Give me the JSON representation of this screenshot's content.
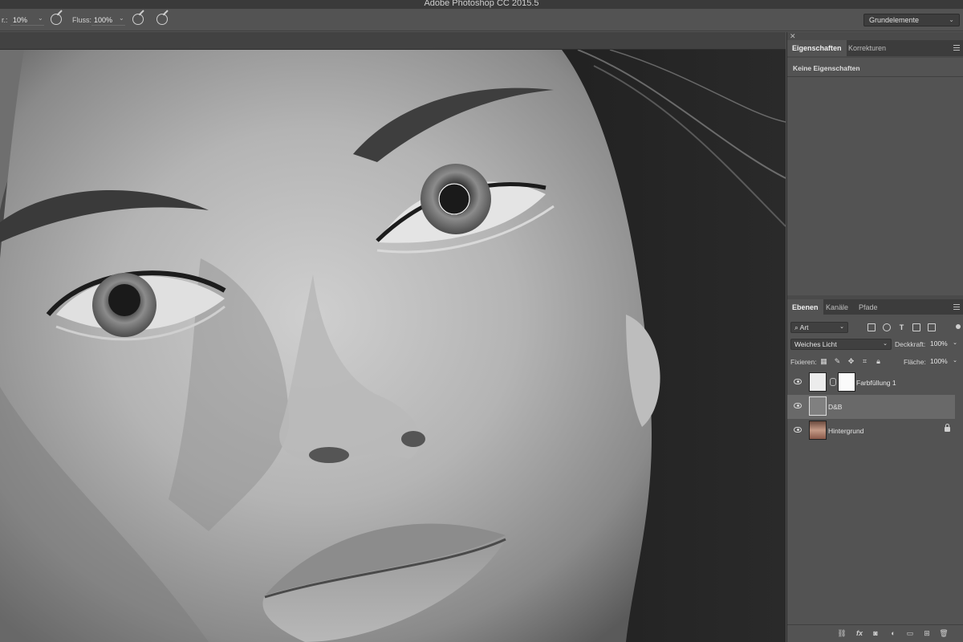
{
  "window": {
    "title": "Adobe Photoshop CC 2015.5"
  },
  "options_bar": {
    "opacity_label_partial": "r.:",
    "opacity_value": "10%",
    "flow_label": "Fluss:",
    "flow_value": "100%",
    "workspace": "Grundelemente"
  },
  "properties_panel": {
    "tabs": [
      {
        "label": "Eigenschaften",
        "active": true
      },
      {
        "label": "Korrekturen",
        "active": false
      }
    ],
    "empty_text": "Keine Eigenschaften"
  },
  "layers_panel": {
    "tabs": [
      {
        "label": "Ebenen",
        "active": true
      },
      {
        "label": "Kanäle",
        "active": false
      },
      {
        "label": "Pfade",
        "active": false
      }
    ],
    "filter_kind": "Art",
    "blend_mode": "Weiches Licht",
    "opacity_label": "Deckkraft:",
    "opacity_value": "100%",
    "lock_label": "Fixieren:",
    "fill_label": "Fläche:",
    "fill_value": "100%",
    "layers": [
      {
        "name": "Farbfüllung 1",
        "visible": true,
        "selected": false,
        "has_mask": true
      },
      {
        "name": "D&B",
        "visible": true,
        "selected": true,
        "has_mask": false
      },
      {
        "name": "Hintergrund",
        "visible": true,
        "selected": false,
        "locked": true
      }
    ]
  },
  "canvas": {
    "content": "black-and-white portrait close-up, brush cursor over right eye"
  }
}
